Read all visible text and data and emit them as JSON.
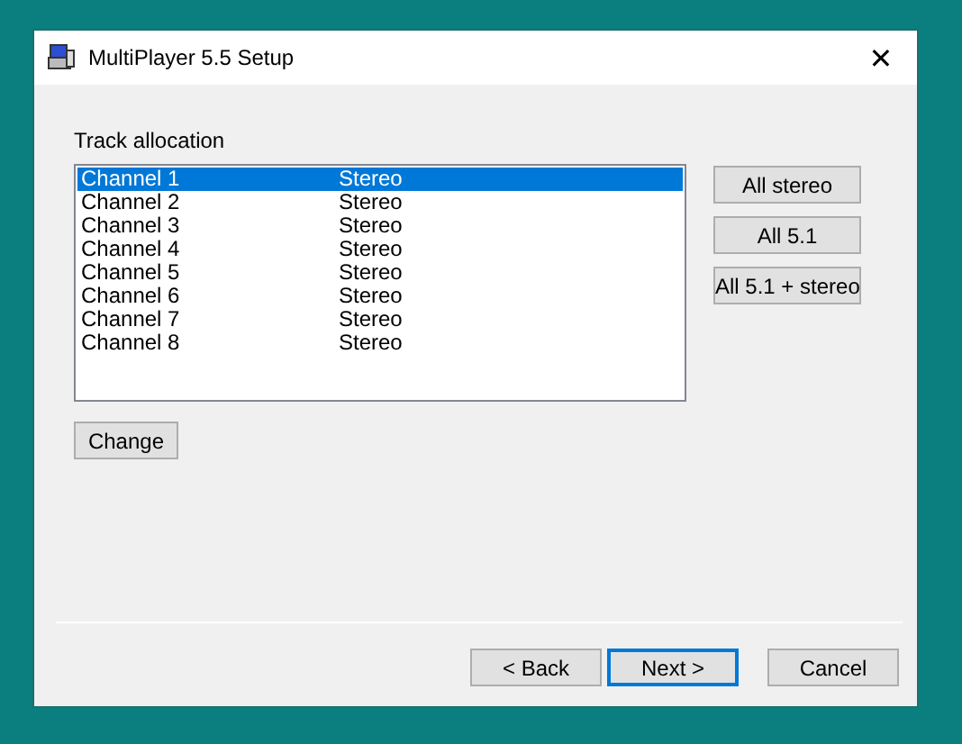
{
  "window": {
    "title": "MultiPlayer 5.5 Setup",
    "close": "✕"
  },
  "section_label": "Track allocation",
  "tracks": [
    {
      "channel": "Channel 1",
      "mode": "Stereo",
      "selected": true
    },
    {
      "channel": "Channel 2",
      "mode": "Stereo",
      "selected": false
    },
    {
      "channel": "Channel 3",
      "mode": "Stereo",
      "selected": false
    },
    {
      "channel": "Channel 4",
      "mode": "Stereo",
      "selected": false
    },
    {
      "channel": "Channel 5",
      "mode": "Stereo",
      "selected": false
    },
    {
      "channel": "Channel 6",
      "mode": "Stereo",
      "selected": false
    },
    {
      "channel": "Channel 7",
      "mode": "Stereo",
      "selected": false
    },
    {
      "channel": "Channel 8",
      "mode": "Stereo",
      "selected": false
    }
  ],
  "side_buttons": [
    "All stereo",
    "All 5.1",
    "All 5.1 + stereo"
  ],
  "change_button": "Change",
  "nav_buttons": [
    {
      "label": "< Back",
      "default": false
    },
    {
      "label": "Next >",
      "default": true
    },
    {
      "label": "Cancel",
      "default": false
    }
  ]
}
